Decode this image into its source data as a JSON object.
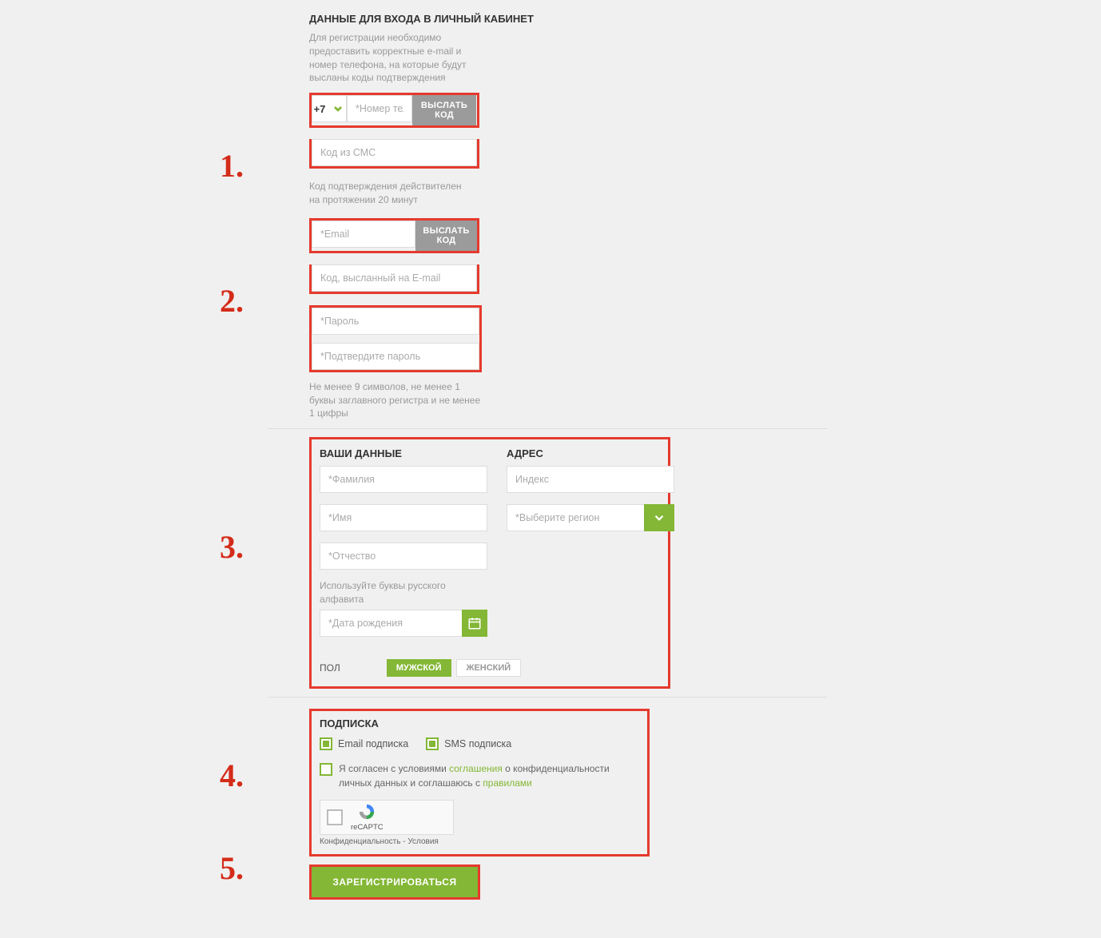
{
  "step_numbers": [
    "1.",
    "2.",
    "3.",
    "4.",
    "5."
  ],
  "login": {
    "title": "ДАННЫЕ ДЛЯ ВХОДА В ЛИЧНЫЙ КАБИНЕТ",
    "hint": "Для регистрации необходимо предоставить корректные e-mail и номер телефона, на которые будут высланы коды подтверждения",
    "prefix": "+7",
    "phone_placeholder": "*Номер теле",
    "send_code": "ВЫСЛАТЬ КОД",
    "sms_code_placeholder": "Код из СМС",
    "code_valid_hint": "Код подтверждения действителен на протяжении 20 минут",
    "email_placeholder": "*Email",
    "email_code_placeholder": "Код, высланный на E-mail"
  },
  "password": {
    "password_placeholder": "*Пароль",
    "confirm_placeholder": "*Подтвердите пароль",
    "hint": "Не менее 9 символов, не менее 1 буквы заглавного регистра и не менее 1 цифры"
  },
  "personal": {
    "title": "ВАШИ ДАННЫЕ",
    "surname_placeholder": "*Фамилия",
    "name_placeholder": "*Имя",
    "patronymic_placeholder": "*Отчество",
    "alphabet_hint": "Используйте буквы русского алфавита",
    "dob_placeholder": "*Дата рождения",
    "gender_label": "ПОЛ",
    "gender_male": "МУЖСКОЙ",
    "gender_female": "ЖЕНСКИЙ"
  },
  "address": {
    "title": "АДРЕС",
    "index_placeholder": "Индекс",
    "region_placeholder": "*Выберите регион"
  },
  "subscription": {
    "title": "ПОДПИСКА",
    "email_sub": "Email подписка",
    "sms_sub": "SMS подписка",
    "terms_pre": "Я согласен с условиями ",
    "terms_link1": "соглашения",
    "terms_mid": " о конфиденциальности личных данных и соглашаюсь с ",
    "terms_link2": "правилами",
    "recaptcha_label": "reCAPTC",
    "recaptcha_foot": "Конфиденциальность - Условия"
  },
  "register_button": "ЗАРЕГИСТРИРОВАТЬСЯ",
  "colors": {
    "accent": "#83b735",
    "highlight": "#e53a2e"
  }
}
